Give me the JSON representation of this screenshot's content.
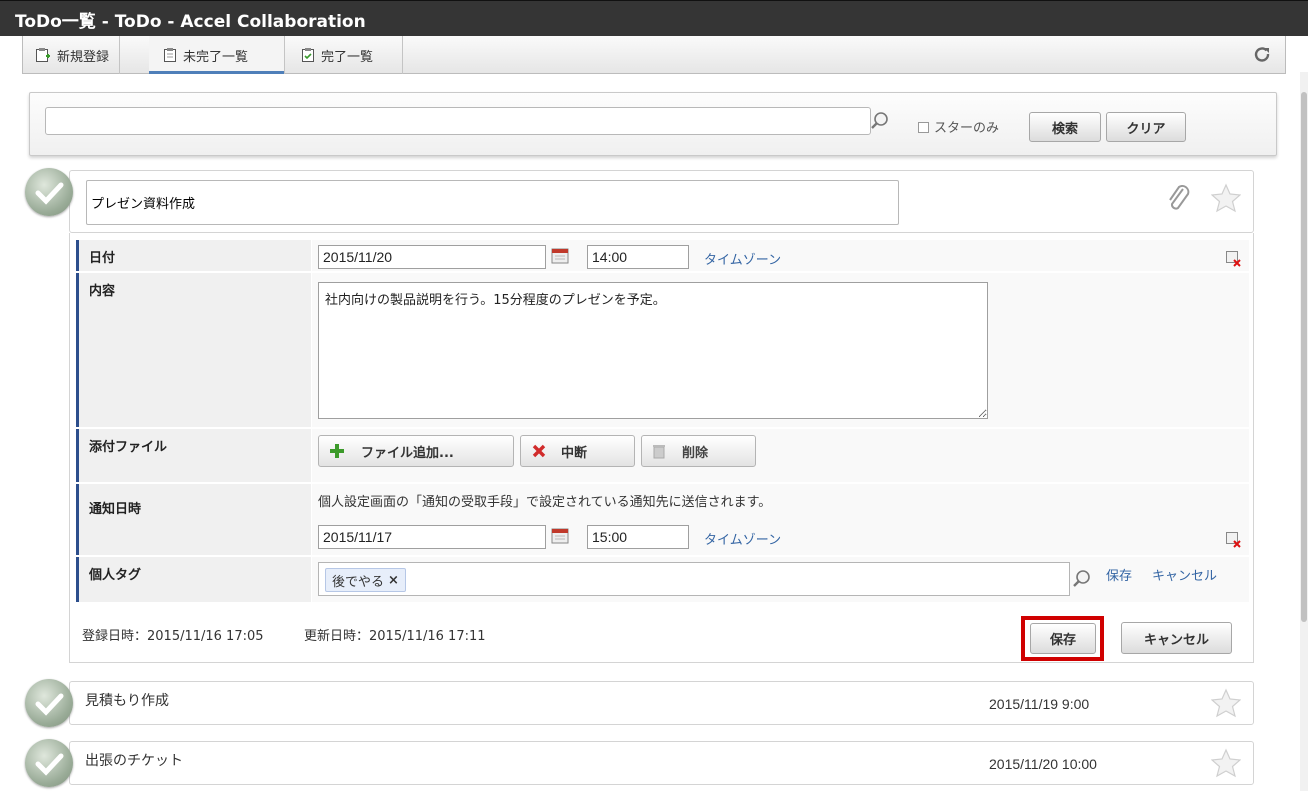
{
  "window": {
    "title": "ToDo一覧 - ToDo - Accel Collaboration"
  },
  "tabs": [
    {
      "label": "新規登録",
      "icon": "new-register-icon"
    },
    {
      "label": "未完了一覧",
      "icon": "incomplete-list-icon",
      "active": true
    },
    {
      "label": "完了一覧",
      "icon": "complete-list-icon"
    }
  ],
  "search": {
    "value": "",
    "placeholder": "",
    "star_only_label": "スターのみ",
    "search_button": "検索",
    "clear_button": "クリア"
  },
  "todo": {
    "title": "プレゼン資料作成",
    "date": {
      "label": "日付",
      "date": "2015/11/20",
      "time": "14:00",
      "timezone_link": "タイムゾーン"
    },
    "content": {
      "label": "内容",
      "text": "社内向けの製品説明を行う。15分程度のプレゼンを予定。"
    },
    "attachment": {
      "label": "添付ファイル",
      "add_button": "ファイル追加...",
      "abort_button": "中断",
      "delete_button": "削除"
    },
    "notify": {
      "label": "通知日時",
      "note": "個人設定画面の「通知の受取手段」で設定されている通知先に送信されます。",
      "date": "2015/11/17",
      "time": "15:00",
      "timezone_link": "タイムゾーン"
    },
    "tag": {
      "label": "個人タグ",
      "chip": "後でやる",
      "chip_close": "×",
      "save_link": "保存",
      "cancel_link": "キャンセル"
    },
    "meta": {
      "registered": "登録日時：2015/11/16 17:05",
      "updated": "更新日時：2015/11/16 17:11"
    },
    "save_button": "保存",
    "cancel_button": "キャンセル"
  },
  "items": [
    {
      "title": "見積もり作成",
      "date": "2015/11/19 9:00"
    },
    {
      "title": "出張のチケット",
      "date": "2015/11/20 10:00"
    }
  ],
  "colors": {
    "titlebar": "#353535",
    "accent": "#2c4e8c",
    "highlight": "#d00000",
    "link": "#3465a4"
  }
}
